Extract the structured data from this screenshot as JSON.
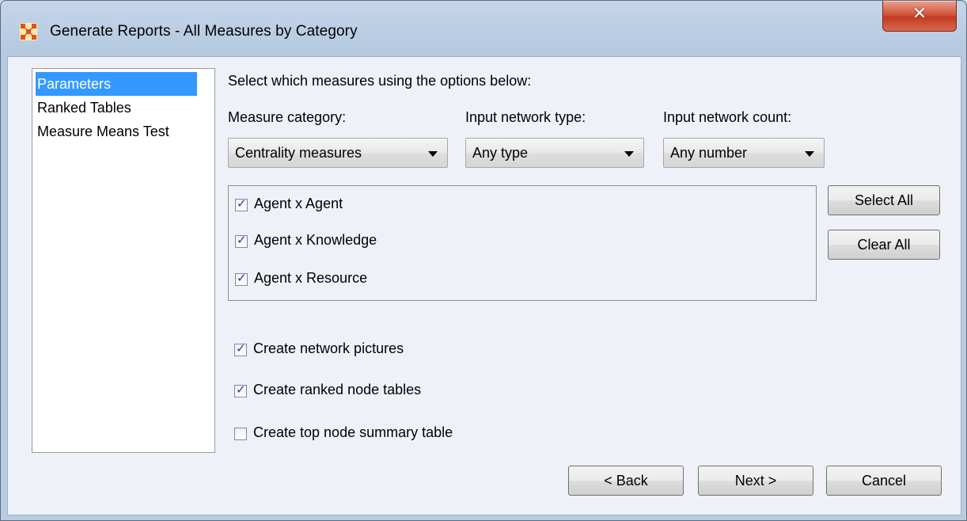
{
  "window": {
    "title": "Generate Reports - All Measures by Category",
    "close_symbol": "✕"
  },
  "nav": {
    "items": [
      {
        "label": "Parameters",
        "selected": true
      },
      {
        "label": "Ranked Tables",
        "selected": false
      },
      {
        "label": "Measure Means Test",
        "selected": false
      }
    ]
  },
  "main": {
    "instruction": "Select which measures using the options below:",
    "filters": {
      "category_label": "Measure category:",
      "category_value": "Centrality measures",
      "type_label": "Input network type:",
      "type_value": "Any type",
      "count_label": "Input network count:",
      "count_value": "Any number"
    },
    "networks": [
      {
        "label": "Agent x Agent",
        "checked": true
      },
      {
        "label": "Agent x Knowledge",
        "checked": true
      },
      {
        "label": "Agent x Resource",
        "checked": true
      }
    ],
    "select_all_label": "Select All",
    "clear_all_label": "Clear All",
    "options": [
      {
        "label": "Create network pictures",
        "checked": true
      },
      {
        "label": "Create ranked node tables",
        "checked": true
      },
      {
        "label": "Create top node summary table",
        "checked": false
      }
    ]
  },
  "footer": {
    "back_label": "< Back",
    "next_label": "Next >",
    "cancel_label": "Cancel"
  },
  "icons": {
    "app": "app-grid-icon",
    "close": "close-icon",
    "dropdown": "chevron-down-icon",
    "check": "checkmark-icon"
  },
  "colors": {
    "selection": "#3399ff",
    "close_button": "#c8452b",
    "app_icon": "#e0501c"
  }
}
